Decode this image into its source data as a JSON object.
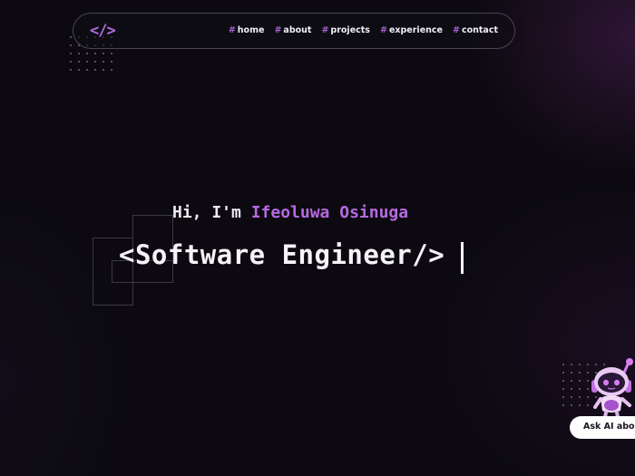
{
  "nav": {
    "logo": "</>",
    "hash": "#",
    "links": [
      {
        "label": "home"
      },
      {
        "label": "about"
      },
      {
        "label": "projects"
      },
      {
        "label": "experience"
      },
      {
        "label": "contact"
      }
    ]
  },
  "hero": {
    "greeting_prefix": "Hi, I'm",
    "name": "Ifeoluwa Osinuga",
    "role": "<Software Engineer/>"
  },
  "assistant": {
    "icon": "robot-icon",
    "button_label": "Ask AI about"
  },
  "colors": {
    "background": "#0c0a10",
    "accent": "#b46ae0",
    "text": "#f5f2f8"
  }
}
